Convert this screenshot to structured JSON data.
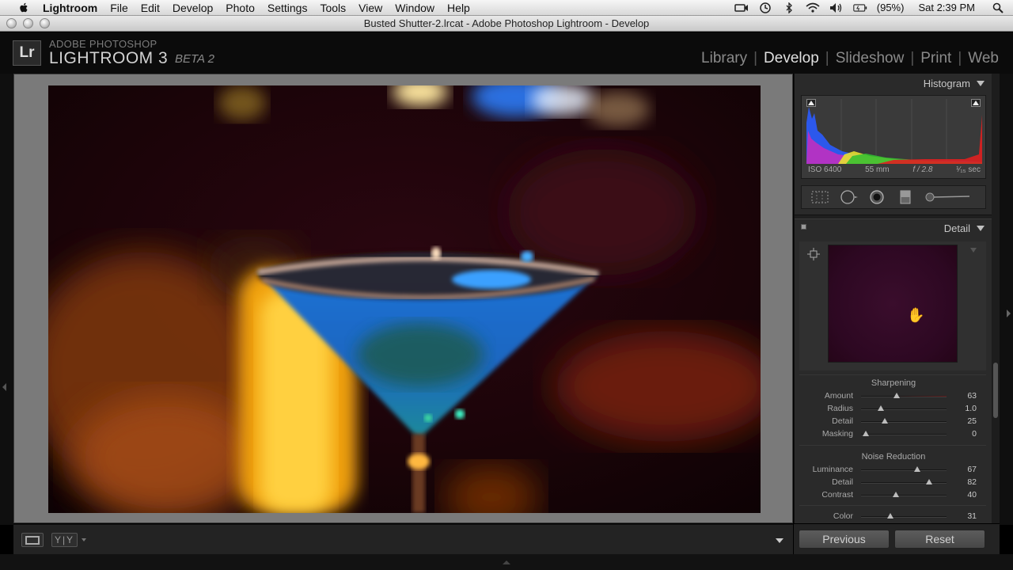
{
  "menubar": {
    "app_name": "Lightroom",
    "items": [
      "File",
      "Edit",
      "Develop",
      "Photo",
      "Settings",
      "Tools",
      "View",
      "Window",
      "Help"
    ],
    "battery": "(95%)",
    "clock": "Sat 2:39 PM"
  },
  "window": {
    "title": "Busted Shutter-2.lrcat - Adobe Photoshop Lightroom - Develop"
  },
  "identity": {
    "top_line": "ADOBE PHOTOSHOP",
    "product": "LIGHTROOM 3",
    "beta": "BETA 2"
  },
  "modules": [
    "Library",
    "Develop",
    "Slideshow",
    "Print",
    "Web"
  ],
  "active_module": "Develop",
  "histogram": {
    "title": "Histogram",
    "iso": "ISO 6400",
    "focal_length": "55 mm",
    "aperture": "f / 2.8",
    "shutter": "¹⁄₁₅ sec"
  },
  "detail": {
    "title": "Detail",
    "sharpening": {
      "title": "Sharpening",
      "amount": {
        "label": "Amount",
        "value": "63",
        "fraction": 0.42
      },
      "radius": {
        "label": "Radius",
        "value": "1.0",
        "fraction": 0.23
      },
      "detail": {
        "label": "Detail",
        "value": "25",
        "fraction": 0.28
      },
      "masking": {
        "label": "Masking",
        "value": "0",
        "fraction": 0.06
      }
    },
    "noise_reduction": {
      "title": "Noise Reduction",
      "luminance": {
        "label": "Luminance",
        "value": "67",
        "fraction": 0.66
      },
      "detail": {
        "label": "Detail",
        "value": "82",
        "fraction": 0.8
      },
      "contrast": {
        "label": "Contrast",
        "value": "40",
        "fraction": 0.41
      },
      "color": {
        "label": "Color",
        "value": "31",
        "fraction": 0.34
      }
    }
  },
  "buttons": {
    "previous": "Previous",
    "reset": "Reset"
  },
  "toolbar": {
    "compare_glyph": "Y|Y"
  },
  "colors": {
    "panel_bg": "#2a2a2a",
    "image_surround": "#7a7a7a",
    "preview_bg": "#2d0822"
  }
}
